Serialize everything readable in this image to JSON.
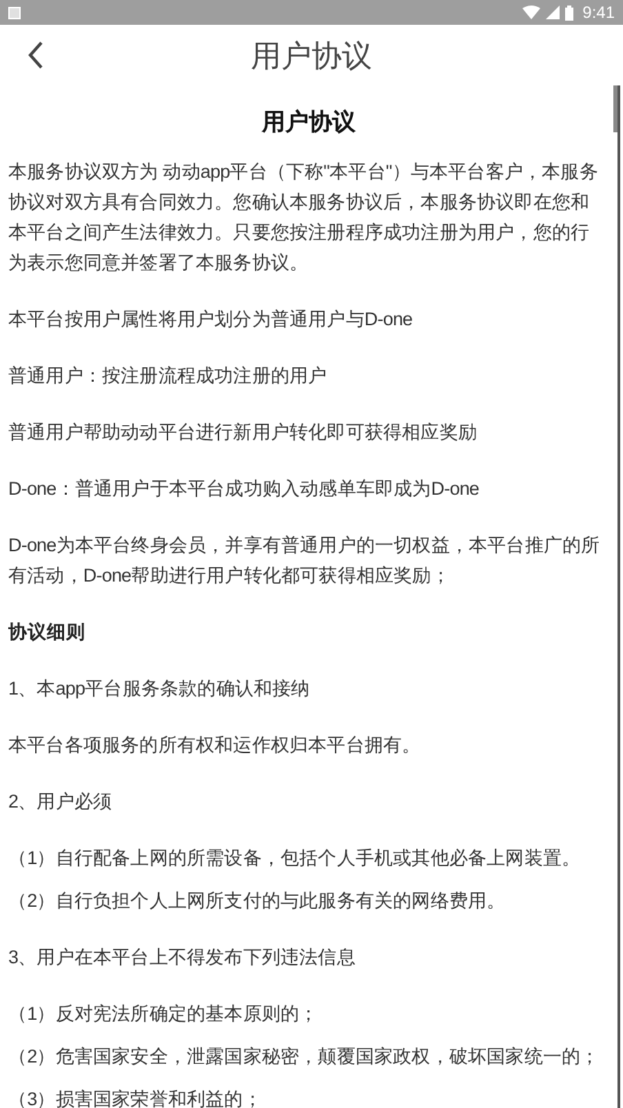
{
  "status_bar": {
    "time": "9:41"
  },
  "header": {
    "title": "用户协议"
  },
  "document": {
    "title": "用户协议",
    "blocks": [
      {
        "kind": "para",
        "text": "本服务协议双方为 动动app平台（下称\"本平台\"）与本平台客户，本服务协议对双方具有合同效力。您确认本服务协议后，本服务协议即在您和本平台之间产生法律效力。只要您按注册程序成功注册为用户，您的行为表示您同意并签署了本服务协议。"
      },
      {
        "kind": "para",
        "text": "本平台按用户属性将用户划分为普通用户与D-one"
      },
      {
        "kind": "para",
        "text": "普通用户：按注册流程成功注册的用户"
      },
      {
        "kind": "para",
        "text": "普通用户帮助动动平台进行新用户转化即可获得相应奖励"
      },
      {
        "kind": "para",
        "text": "D-one：普通用户于本平台成功购入动感单车即成为D-one"
      },
      {
        "kind": "para",
        "text": "D-one为本平台终身会员，并享有普通用户的一切权益，本平台推广的所有活动，D-one帮助进行用户转化都可获得相应奖励；"
      },
      {
        "kind": "heading",
        "text": "协议细则"
      },
      {
        "kind": "para",
        "text": "1、本app平台服务条款的确认和接纳"
      },
      {
        "kind": "para",
        "text": "本平台各项服务的所有权和运作权归本平台拥有。"
      },
      {
        "kind": "para",
        "text": "2、用户必须"
      },
      {
        "kind": "item",
        "text": "（1）自行配备上网的所需设备，包括个人手机或其他必备上网装置。"
      },
      {
        "kind": "item",
        "text": "（2）自行负担个人上网所支付的与此服务有关的网络费用。"
      },
      {
        "kind": "para",
        "text": "3、用户在本平台上不得发布下列违法信息"
      },
      {
        "kind": "item",
        "text": "（1）反对宪法所确定的基本原则的；"
      },
      {
        "kind": "item",
        "text": "（2）危害国家安全，泄露国家秘密，颠覆国家政权，破坏国家统一的；"
      },
      {
        "kind": "item",
        "text": "（3）损害国家荣誉和利益的；"
      }
    ]
  }
}
